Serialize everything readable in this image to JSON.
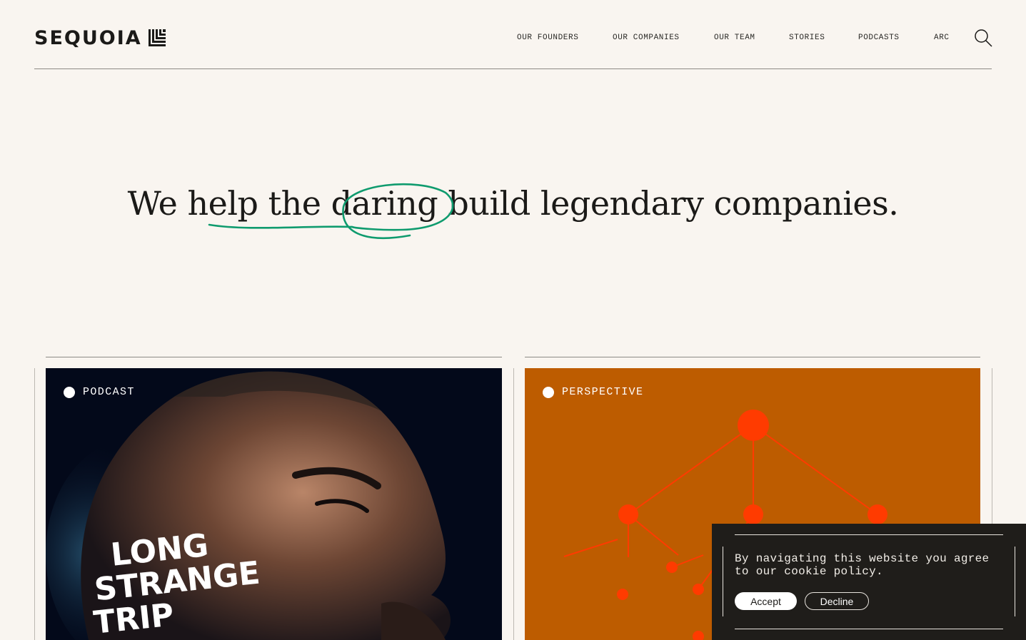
{
  "header": {
    "logo_text": "SEQUOIA",
    "nav": [
      {
        "label": "OUR FOUNDERS"
      },
      {
        "label": "OUR COMPANIES"
      },
      {
        "label": "OUR TEAM"
      },
      {
        "label": "STORIES"
      },
      {
        "label": "PODCASTS"
      },
      {
        "label": "ARC"
      }
    ],
    "search_icon": "search-icon"
  },
  "hero": {
    "part1": "We help the ",
    "highlight": "daring",
    "part2": " build legendary companies.",
    "scribble_color": "#0f9b6e"
  },
  "cards": [
    {
      "tag": "PODCAST",
      "art_text": [
        "LONG",
        "STRANGE",
        "TRIP"
      ],
      "background": "#03091a"
    },
    {
      "tag": "PERSPECTIVE",
      "background": "#bd5c00",
      "node_color": "#ff3b00"
    }
  ],
  "cookie": {
    "text": "By navigating this website you agree to our cookie policy.",
    "accept_label": "Accept",
    "decline_label": "Decline"
  }
}
